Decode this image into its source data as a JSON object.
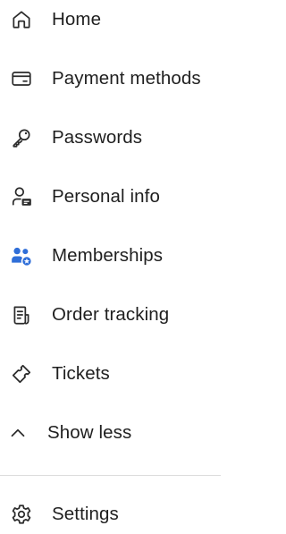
{
  "nav": {
    "items": [
      {
        "label": "Home",
        "icon": "home-icon"
      },
      {
        "label": "Payment methods",
        "icon": "credit-card-icon"
      },
      {
        "label": "Passwords",
        "icon": "key-icon"
      },
      {
        "label": "Personal info",
        "icon": "person-card-icon"
      },
      {
        "label": "Memberships",
        "icon": "people-star-icon"
      },
      {
        "label": "Order tracking",
        "icon": "receipt-icon"
      },
      {
        "label": "Tickets",
        "icon": "ticket-icon"
      }
    ],
    "toggle": {
      "label": "Show less",
      "icon": "chevron-up-icon"
    },
    "settings": {
      "label": "Settings",
      "icon": "gear-icon"
    }
  },
  "colors": {
    "text": "#1f1f1f",
    "icon_stroke": "#2b2b2b",
    "memberships_accent": "#2f6ed8",
    "divider": "#dcdcdc"
  }
}
